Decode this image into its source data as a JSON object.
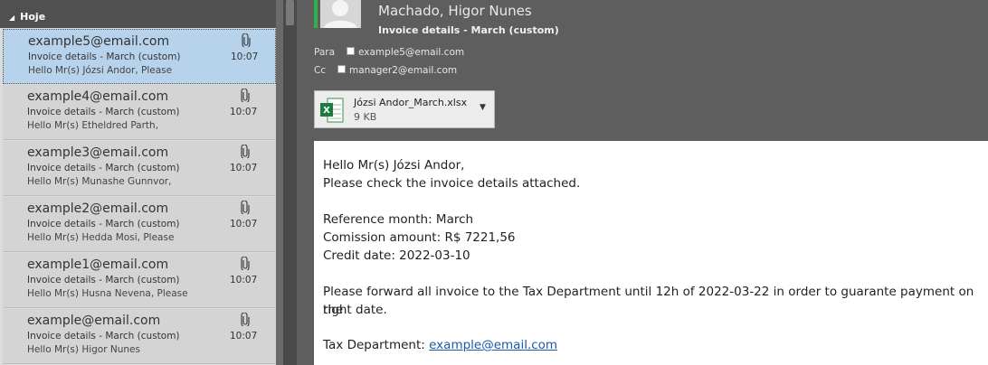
{
  "list": {
    "group_label": "Hoje",
    "messages": [
      {
        "from": "example5@email.com",
        "subject": "Invoice details - March (custom)",
        "preview": "Hello Mr(s) Józsi Andor,  Please",
        "time": "10:07",
        "selected": true
      },
      {
        "from": "example4@email.com",
        "subject": "Invoice details - March (custom)",
        "preview": "Hello Mr(s) Etheldred Parth,",
        "time": "10:07",
        "selected": false
      },
      {
        "from": "example3@email.com",
        "subject": "Invoice details - March (custom)",
        "preview": "Hello Mr(s) Munashe Gunnvor,",
        "time": "10:07",
        "selected": false
      },
      {
        "from": "example2@email.com",
        "subject": "Invoice details - March (custom)",
        "preview": "Hello Mr(s) Hedda Mosi,  Please",
        "time": "10:07",
        "selected": false
      },
      {
        "from": "example1@email.com",
        "subject": "Invoice details - March (custom)",
        "preview": "Hello Mr(s) Husna Nevena,  Please",
        "time": "10:07",
        "selected": false
      },
      {
        "from": "example@email.com",
        "subject": "Invoice details - March (custom)",
        "preview": "Hello Mr(s) Higor Nunes",
        "time": "10:07",
        "selected": false
      }
    ]
  },
  "reading": {
    "sender": "Machado, Higor Nunes",
    "subject": "Invoice details - March (custom)",
    "to_label": "Para",
    "to_address": "example5@email.com",
    "cc_label": "Cc",
    "cc_address": "manager2@email.com",
    "attachment": {
      "name": "Józsi Andor_March.xlsx",
      "size": "9 KB"
    },
    "body": {
      "greeting": "Hello Mr(s) Józsi Andor,",
      "line1": "Please check the invoice details attached.",
      "ref": "Reference month: March",
      "amount": "Comission amount: R$ 7221,56",
      "credit": "Credit date: 2022-03-10",
      "forward1": "Please forward all invoice to the Tax Department until 12h of 2022-03-22 in order to guarante payment on the",
      "forward2": "right date.",
      "tax_label": "Tax Department: ",
      "tax_link": "example@email.com"
    }
  },
  "colors": {
    "accent_green": "#2db24a",
    "selected_bg": "#b7d3ec",
    "link": "#1a5aa8"
  },
  "icons": [
    "paperclip-icon",
    "excel-file-icon",
    "chevron-down-icon",
    "avatar-icon",
    "triangle-collapse-icon"
  ]
}
